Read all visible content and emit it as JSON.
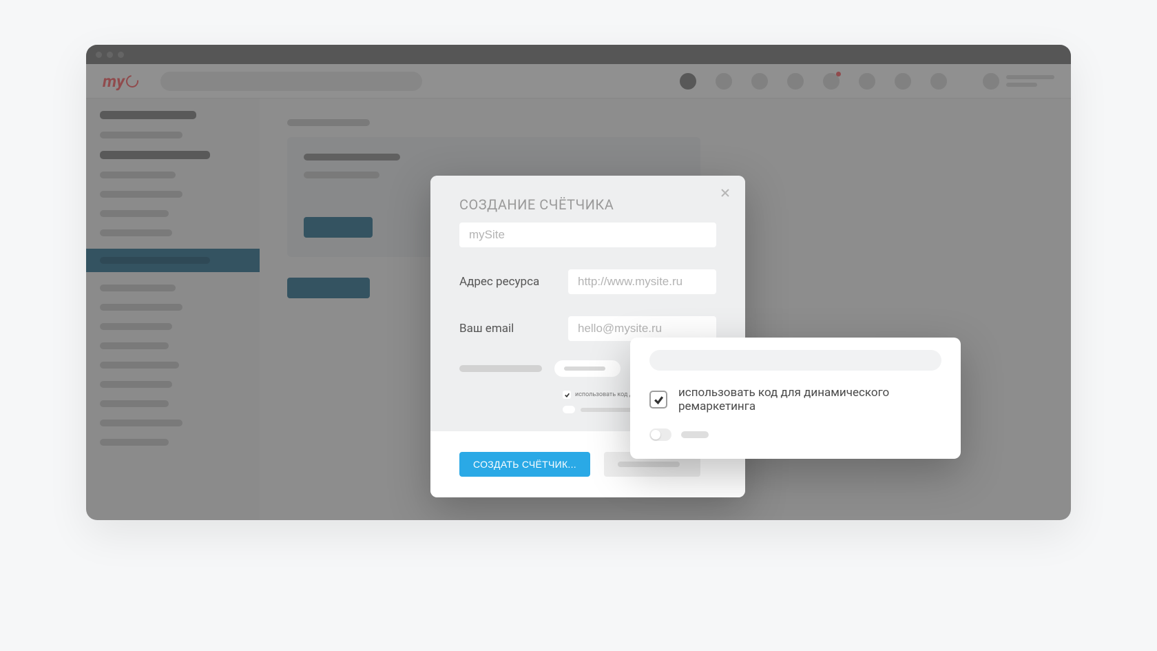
{
  "logo_text": "my",
  "modal": {
    "title": "СОЗДАНИЕ СЧЁТЧИКА",
    "name_placeholder": "mySite",
    "resource_label": "Адрес ресурса",
    "resource_placeholder": "http://www.mysite.ru",
    "email_label": "Ваш email",
    "email_placeholder": "hello@mysite.ru",
    "tiny_checkbox_label": "использовать код для д",
    "submit_label": "СОЗДАТЬ СЧЁТЧИК..."
  },
  "callout": {
    "checkbox_label": "использовать код для динамического ремаркетинга"
  }
}
